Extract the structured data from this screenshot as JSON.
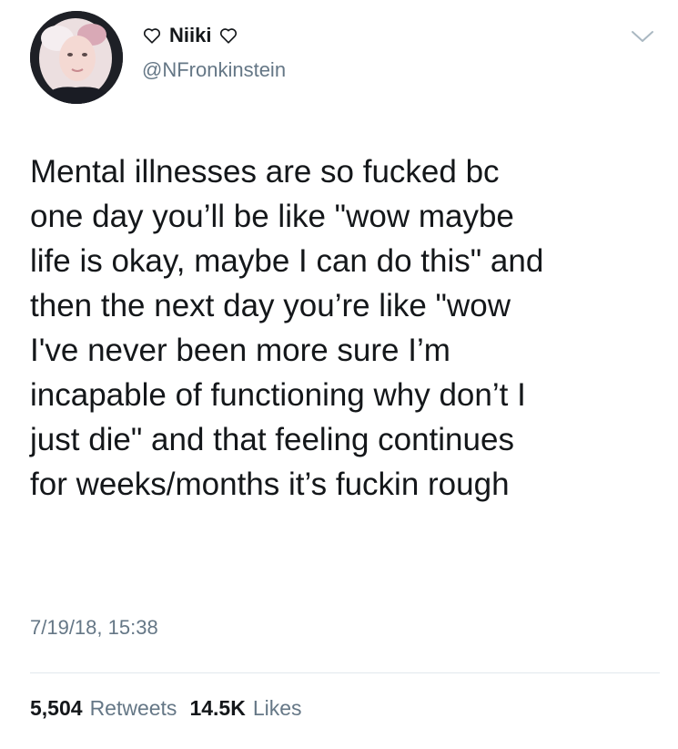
{
  "tweet": {
    "author": {
      "display_name": "Niiki",
      "handle": "@NFronkinstein",
      "name_decoration_icon": "heart-outline-icon"
    },
    "text": "Mental illnesses are so fucked bc\none day you’ll be like \"wow maybe\nlife is okay, maybe I can do this\" and\nthen the next day you’re like \"wow\nI've never been more sure I’m\nincapable of functioning why don’t I\njust die\" and that feeling continues\nfor weeks/months it’s fuckin rough",
    "timestamp": "7/19/18, 15:38",
    "stats": {
      "retweets_count": "5,504",
      "retweets_label": "Retweets",
      "likes_count": "14.5K",
      "likes_label": "Likes"
    }
  },
  "colors": {
    "text_primary": "#14171a",
    "text_secondary": "#657786",
    "divider": "#e1e8ed",
    "background": "#ffffff"
  },
  "icons": {
    "menu": "chevron-down-icon"
  }
}
